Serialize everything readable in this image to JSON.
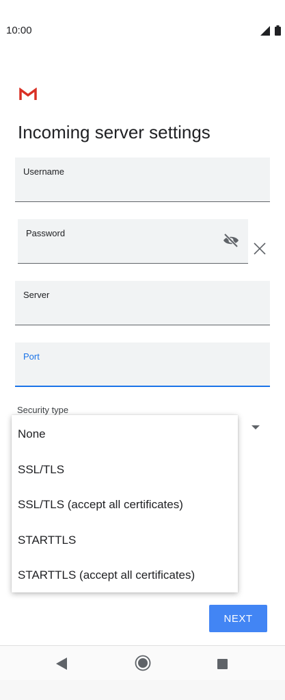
{
  "status_bar": {
    "time": "10:00"
  },
  "title": "Incoming server settings",
  "fields": {
    "username": {
      "label": "Username"
    },
    "password": {
      "label": "Password"
    },
    "server": {
      "label": "Server"
    },
    "port": {
      "label": "Port"
    }
  },
  "security_type": {
    "label": "Security type",
    "options": [
      "None",
      "SSL/TLS",
      "SSL/TLS (accept all certificates)",
      "STARTTLS",
      "STARTTLS (accept all certificates)"
    ]
  },
  "next_button": "NEXT",
  "colors": {
    "accent": "#1a73e8",
    "button": "#4285f4",
    "gmail_red": "#d93025"
  },
  "icons": [
    "gmail-logo",
    "visibility-off-icon",
    "close-icon",
    "signal-icon",
    "battery-icon",
    "dropdown-arrow-icon",
    "nav-back-icon",
    "nav-home-icon",
    "nav-recent-icon"
  ]
}
